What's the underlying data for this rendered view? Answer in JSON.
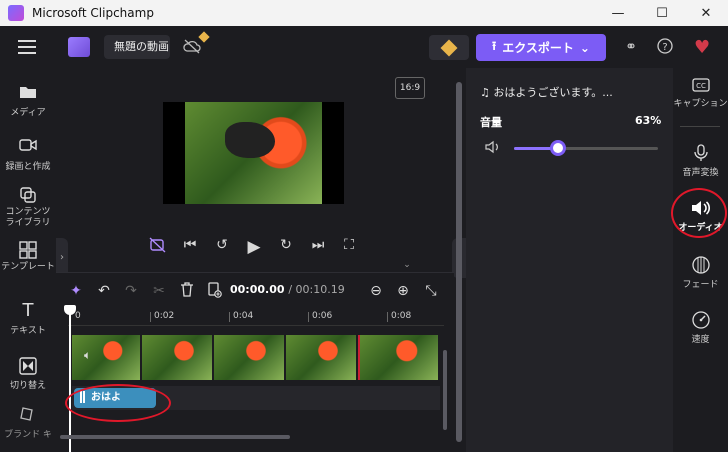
{
  "window": {
    "title": "Microsoft Clipchamp",
    "minimize": "—",
    "maximize": "☐",
    "close": "✕"
  },
  "header": {
    "project_name": "無題の動画",
    "export_label": "エクスポート",
    "export_chevron": "⌄"
  },
  "left_sidebar": {
    "items": [
      {
        "label": "メディア",
        "icon": "folder-icon"
      },
      {
        "label": "録画と作成",
        "icon": "camera-icon"
      },
      {
        "label": "コンテンツ ライブラリ",
        "icon": "library-icon"
      },
      {
        "label": "テンプレート",
        "icon": "template-icon"
      },
      {
        "label": "テキスト",
        "icon": "text-icon"
      },
      {
        "label": "切り替え",
        "icon": "transition-icon"
      },
      {
        "label": "ブランド キ",
        "icon": "brand-icon"
      }
    ]
  },
  "preview": {
    "aspect_ratio": "16:9"
  },
  "timeline": {
    "current_time": "00:00.00",
    "total_time": "/ 00:10.19",
    "ruler": [
      "0",
      "0:02",
      "0:04",
      "0:06",
      "0:08"
    ],
    "audio_clip_label": "おはよ"
  },
  "properties": {
    "track_title": "おはようございます。...",
    "volume_label": "音量",
    "volume_percent": "63%",
    "volume_value": 0.63
  },
  "right_sidebar": {
    "items": [
      {
        "label": "キャプション",
        "icon": "captions-icon"
      },
      {
        "label": "音声変換",
        "icon": "voice-icon"
      },
      {
        "label": "オーディオ",
        "icon": "audio-icon",
        "active": true
      },
      {
        "label": "フェード",
        "icon": "fade-icon"
      },
      {
        "label": "速度",
        "icon": "speed-icon"
      }
    ]
  },
  "colors": {
    "accent": "#7c5cf5",
    "audio_clip": "#3c8fbd",
    "highlight_ellipse": "#e0182a"
  }
}
